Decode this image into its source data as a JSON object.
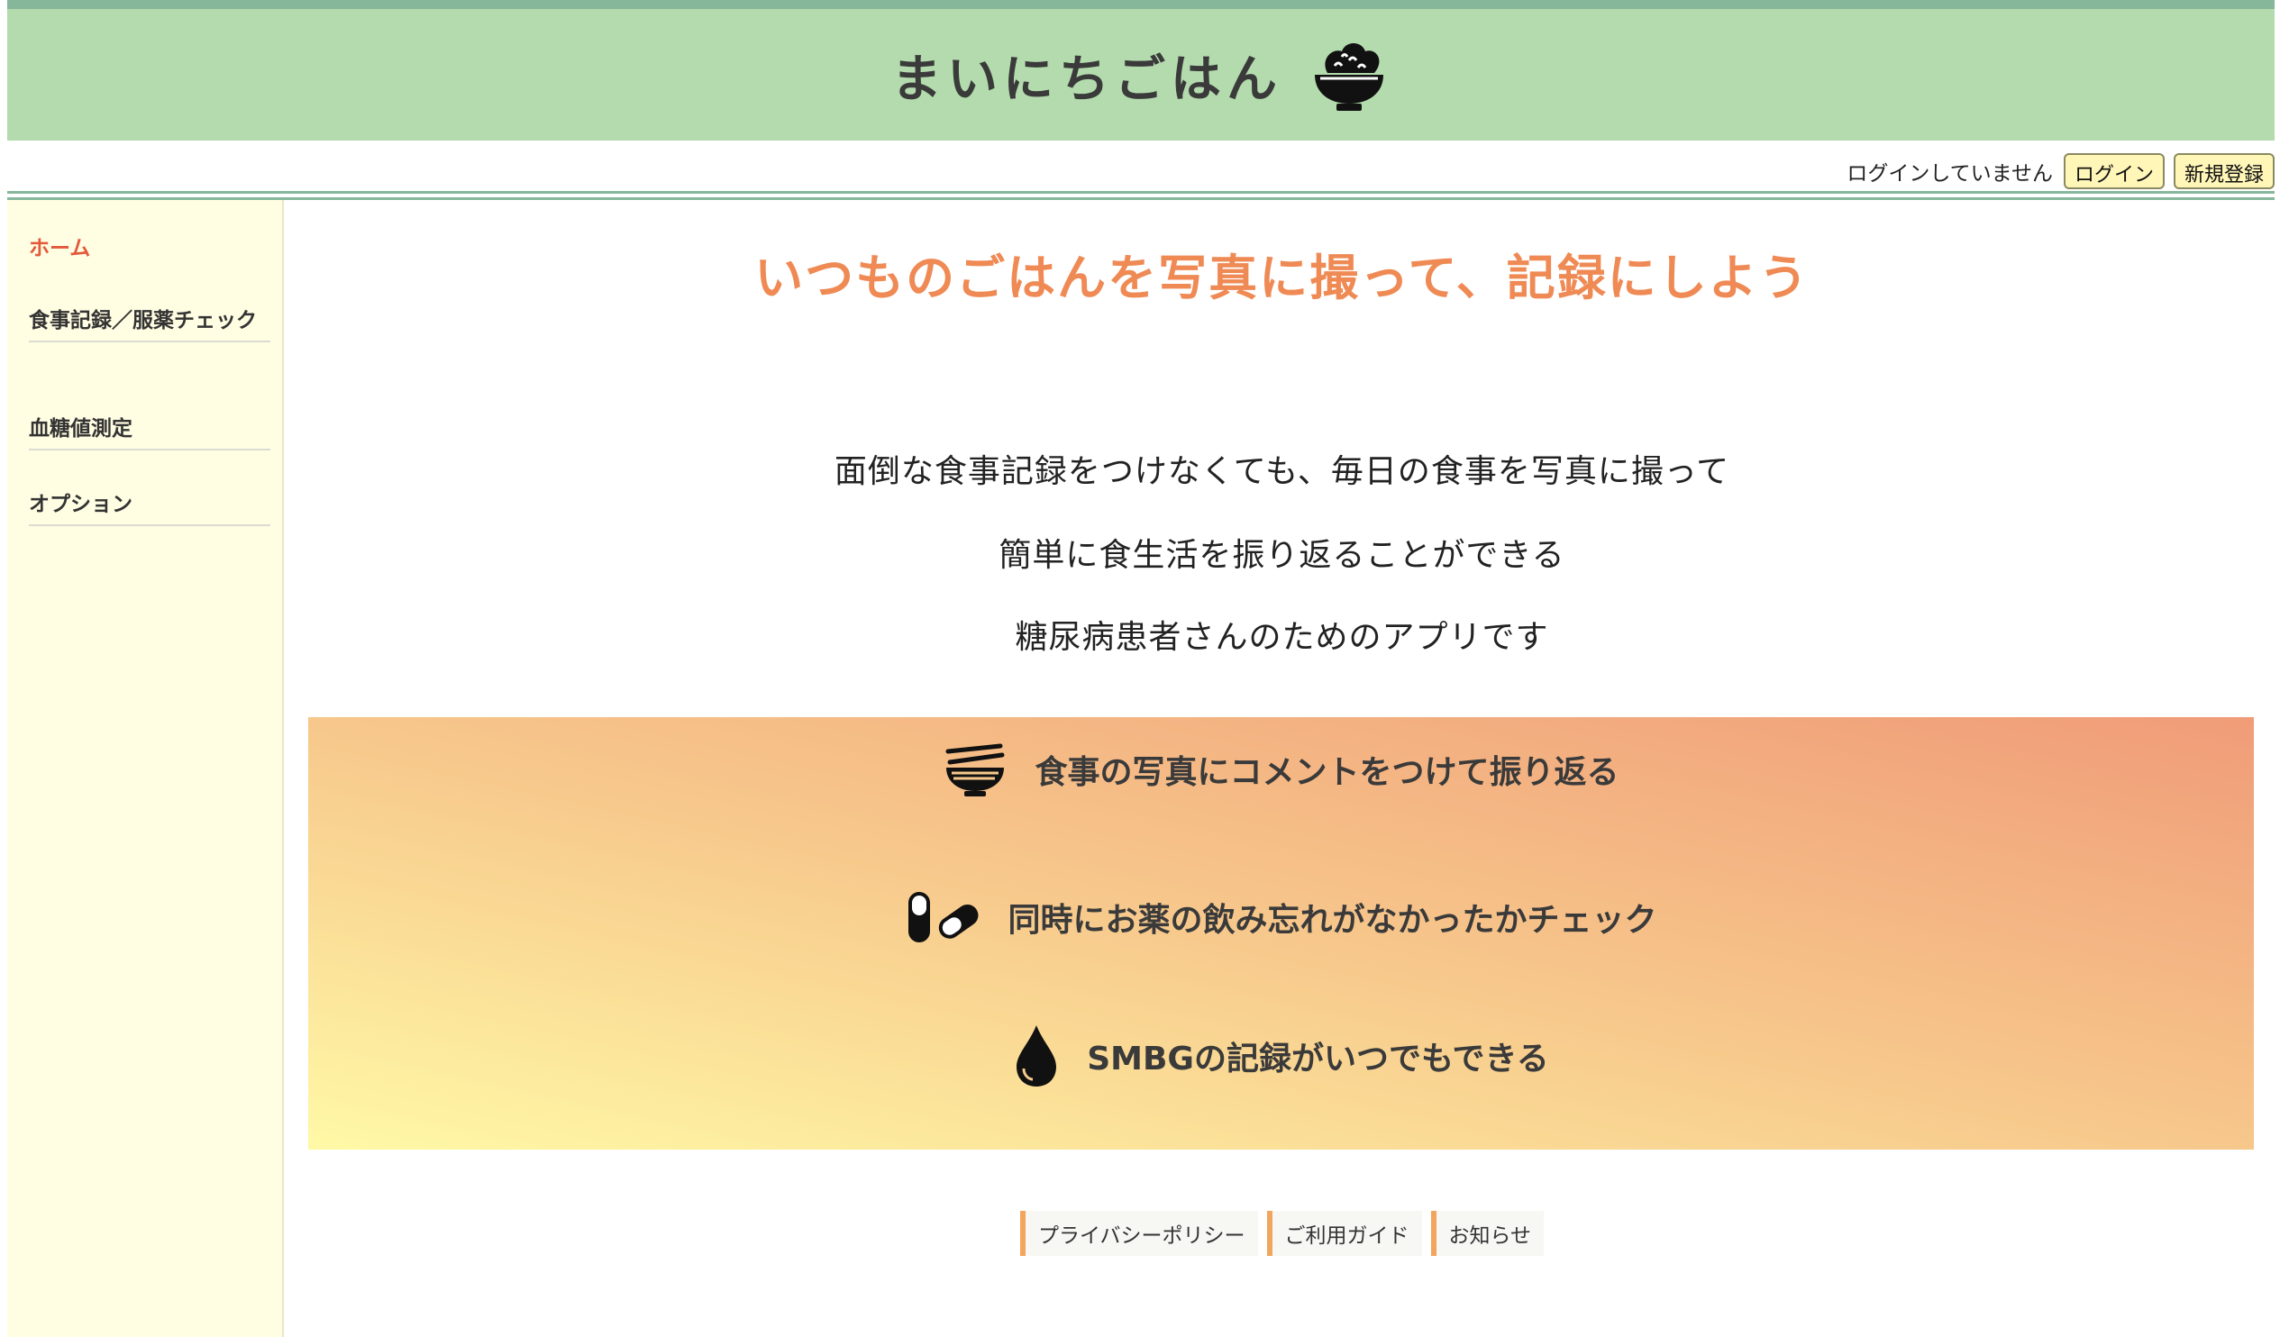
{
  "header": {
    "title": "まいにちごはん",
    "logo_icon": "rice-bowl-icon"
  },
  "auth": {
    "status": "ログインしていません",
    "login_label": "ログイン",
    "signup_label": "新規登録"
  },
  "sidebar": {
    "items": [
      {
        "label": "ホーム",
        "active": true
      },
      {
        "label": "食事記録／服薬チェック"
      },
      {
        "label": "血糖値測定"
      },
      {
        "label": "オプション"
      }
    ]
  },
  "main": {
    "headline": "いつものごはんを写真に撮って、記録にしよう",
    "description": [
      "面倒な食事記録をつけなくても、毎日の食事を写真に撮って",
      "簡単に食生活を振り返ることができる",
      "糖尿病患者さんのためのアプリです"
    ],
    "features": [
      {
        "icon": "bowl-chopsticks-icon",
        "text": "食事の写真にコメントをつけて振り返る"
      },
      {
        "icon": "pills-icon",
        "text": "同時にお薬の飲み忘れがなかったかチェック"
      },
      {
        "icon": "blood-drop-icon",
        "text": "SMBGの記録がいつでもできる"
      }
    ]
  },
  "footer": {
    "links": [
      "プライバシーポリシー",
      "ご利用ガイド",
      "お知らせ"
    ]
  },
  "colors": {
    "header_bg": "#b3dbad",
    "accent_orange": "#ef8a55",
    "active_nav": "#e4593b",
    "sidebar_bg": "#fffde2"
  }
}
